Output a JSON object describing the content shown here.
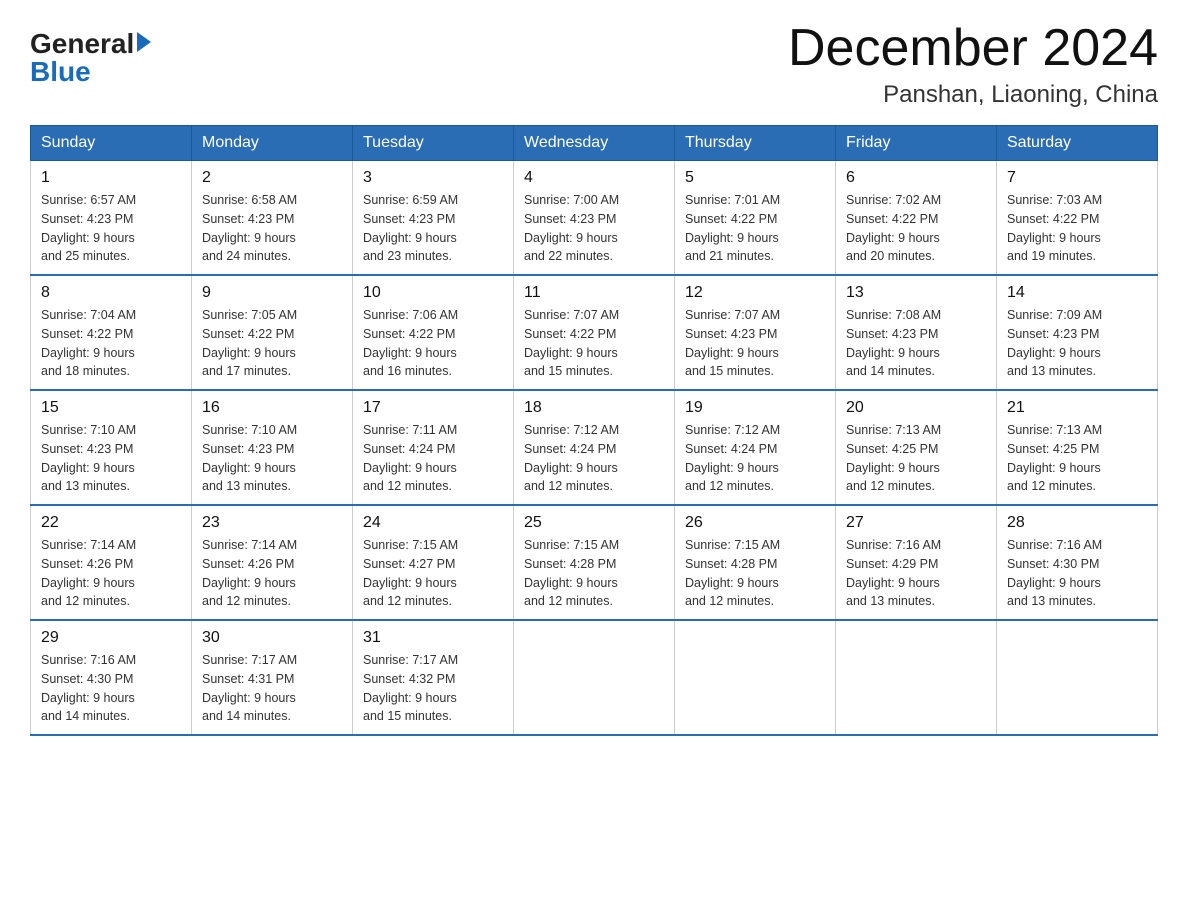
{
  "header": {
    "logo_line1": "General",
    "logo_line2": "Blue",
    "title": "December 2024",
    "subtitle": "Panshan, Liaoning, China"
  },
  "days_of_week": [
    "Sunday",
    "Monday",
    "Tuesday",
    "Wednesday",
    "Thursday",
    "Friday",
    "Saturday"
  ],
  "weeks": [
    [
      {
        "day": "1",
        "sunrise": "6:57 AM",
        "sunset": "4:23 PM",
        "daylight": "9 hours and 25 minutes."
      },
      {
        "day": "2",
        "sunrise": "6:58 AM",
        "sunset": "4:23 PM",
        "daylight": "9 hours and 24 minutes."
      },
      {
        "day": "3",
        "sunrise": "6:59 AM",
        "sunset": "4:23 PM",
        "daylight": "9 hours and 23 minutes."
      },
      {
        "day": "4",
        "sunrise": "7:00 AM",
        "sunset": "4:23 PM",
        "daylight": "9 hours and 22 minutes."
      },
      {
        "day": "5",
        "sunrise": "7:01 AM",
        "sunset": "4:22 PM",
        "daylight": "9 hours and 21 minutes."
      },
      {
        "day": "6",
        "sunrise": "7:02 AM",
        "sunset": "4:22 PM",
        "daylight": "9 hours and 20 minutes."
      },
      {
        "day": "7",
        "sunrise": "7:03 AM",
        "sunset": "4:22 PM",
        "daylight": "9 hours and 19 minutes."
      }
    ],
    [
      {
        "day": "8",
        "sunrise": "7:04 AM",
        "sunset": "4:22 PM",
        "daylight": "9 hours and 18 minutes."
      },
      {
        "day": "9",
        "sunrise": "7:05 AM",
        "sunset": "4:22 PM",
        "daylight": "9 hours and 17 minutes."
      },
      {
        "day": "10",
        "sunrise": "7:06 AM",
        "sunset": "4:22 PM",
        "daylight": "9 hours and 16 minutes."
      },
      {
        "day": "11",
        "sunrise": "7:07 AM",
        "sunset": "4:22 PM",
        "daylight": "9 hours and 15 minutes."
      },
      {
        "day": "12",
        "sunrise": "7:07 AM",
        "sunset": "4:23 PM",
        "daylight": "9 hours and 15 minutes."
      },
      {
        "day": "13",
        "sunrise": "7:08 AM",
        "sunset": "4:23 PM",
        "daylight": "9 hours and 14 minutes."
      },
      {
        "day": "14",
        "sunrise": "7:09 AM",
        "sunset": "4:23 PM",
        "daylight": "9 hours and 13 minutes."
      }
    ],
    [
      {
        "day": "15",
        "sunrise": "7:10 AM",
        "sunset": "4:23 PM",
        "daylight": "9 hours and 13 minutes."
      },
      {
        "day": "16",
        "sunrise": "7:10 AM",
        "sunset": "4:23 PM",
        "daylight": "9 hours and 13 minutes."
      },
      {
        "day": "17",
        "sunrise": "7:11 AM",
        "sunset": "4:24 PM",
        "daylight": "9 hours and 12 minutes."
      },
      {
        "day": "18",
        "sunrise": "7:12 AM",
        "sunset": "4:24 PM",
        "daylight": "9 hours and 12 minutes."
      },
      {
        "day": "19",
        "sunrise": "7:12 AM",
        "sunset": "4:24 PM",
        "daylight": "9 hours and 12 minutes."
      },
      {
        "day": "20",
        "sunrise": "7:13 AM",
        "sunset": "4:25 PM",
        "daylight": "9 hours and 12 minutes."
      },
      {
        "day": "21",
        "sunrise": "7:13 AM",
        "sunset": "4:25 PM",
        "daylight": "9 hours and 12 minutes."
      }
    ],
    [
      {
        "day": "22",
        "sunrise": "7:14 AM",
        "sunset": "4:26 PM",
        "daylight": "9 hours and 12 minutes."
      },
      {
        "day": "23",
        "sunrise": "7:14 AM",
        "sunset": "4:26 PM",
        "daylight": "9 hours and 12 minutes."
      },
      {
        "day": "24",
        "sunrise": "7:15 AM",
        "sunset": "4:27 PM",
        "daylight": "9 hours and 12 minutes."
      },
      {
        "day": "25",
        "sunrise": "7:15 AM",
        "sunset": "4:28 PM",
        "daylight": "9 hours and 12 minutes."
      },
      {
        "day": "26",
        "sunrise": "7:15 AM",
        "sunset": "4:28 PM",
        "daylight": "9 hours and 12 minutes."
      },
      {
        "day": "27",
        "sunrise": "7:16 AM",
        "sunset": "4:29 PM",
        "daylight": "9 hours and 13 minutes."
      },
      {
        "day": "28",
        "sunrise": "7:16 AM",
        "sunset": "4:30 PM",
        "daylight": "9 hours and 13 minutes."
      }
    ],
    [
      {
        "day": "29",
        "sunrise": "7:16 AM",
        "sunset": "4:30 PM",
        "daylight": "9 hours and 14 minutes."
      },
      {
        "day": "30",
        "sunrise": "7:17 AM",
        "sunset": "4:31 PM",
        "daylight": "9 hours and 14 minutes."
      },
      {
        "day": "31",
        "sunrise": "7:17 AM",
        "sunset": "4:32 PM",
        "daylight": "9 hours and 15 minutes."
      },
      null,
      null,
      null,
      null
    ]
  ],
  "labels": {
    "sunrise": "Sunrise:",
    "sunset": "Sunset:",
    "daylight": "Daylight:"
  }
}
